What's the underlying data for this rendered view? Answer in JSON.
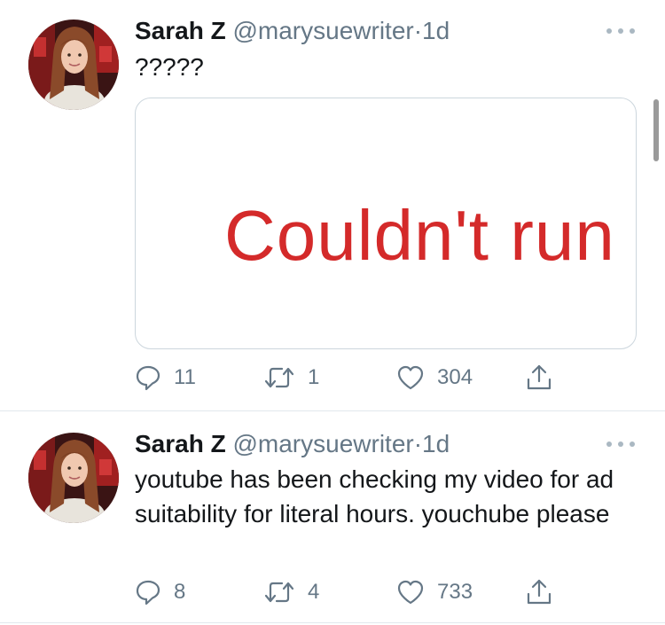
{
  "tweets": [
    {
      "display_name": "Sarah Z",
      "handle": "@marysuewriter",
      "separator": "·",
      "time": "1d",
      "text": "?????",
      "media_text": "Couldn't run",
      "replies": "11",
      "retweets": "1",
      "likes": "304"
    },
    {
      "display_name": "Sarah Z",
      "handle": "@marysuewriter",
      "separator": "·",
      "time": "1d",
      "text": "youtube has been checking my video for ad suitability for literal hours. youchube please",
      "replies": "8",
      "retweets": "4",
      "likes": "733"
    }
  ],
  "icons": {
    "reply": "reply-icon",
    "retweet": "retweet-icon",
    "like": "heart-icon",
    "share": "share-icon",
    "more": "more-icon"
  },
  "colors": {
    "text": "#14171a",
    "secondary": "#657786",
    "border": "#e1e8ed",
    "media_text": "#d42a2a"
  }
}
